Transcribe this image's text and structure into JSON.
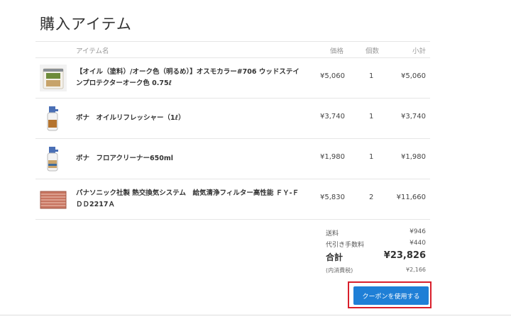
{
  "page": {
    "title": "購入アイテム"
  },
  "table": {
    "headers": {
      "item": "アイテム名",
      "price": "価格",
      "qty": "個数",
      "subtotal": "小計"
    },
    "rows": [
      {
        "name": "【オイル（塗料）/オーク色（明るめ）】オスモカラー#706 ウッドステインプロテクターオーク色 0.75ℓ",
        "price": "¥5,060",
        "qty": "1",
        "subtotal": "¥5,060",
        "icon": "paint-can-icon"
      },
      {
        "name": "ボナ　オイルリフレッシャー（1ℓ）",
        "price": "¥3,740",
        "qty": "1",
        "subtotal": "¥3,740",
        "icon": "spray-bottle-icon"
      },
      {
        "name": "ボナ　フロアクリーナー650ml",
        "price": "¥1,980",
        "qty": "1",
        "subtotal": "¥1,980",
        "icon": "spray-bottle-icon"
      },
      {
        "name": "パナソニック社製 熱交換気システム　給気清浄フィルター高性能 ＦＹ-ＦＤＤ2217Ａ",
        "price": "¥5,830",
        "qty": "2",
        "subtotal": "¥11,660",
        "icon": "filter-icon"
      }
    ]
  },
  "summary": {
    "shipping_label": "送料",
    "shipping": "¥946",
    "cod_label": "代引き手数料",
    "cod": "¥440",
    "total_label": "合計",
    "total": "¥23,826",
    "tax_label": "(内消費税)",
    "tax": "¥2,166"
  },
  "coupon": {
    "label": "クーポンを使用する"
  },
  "colors": {
    "button": "#1f7fd6",
    "highlight": "#d91f2b",
    "border": "#e6e6e6"
  }
}
